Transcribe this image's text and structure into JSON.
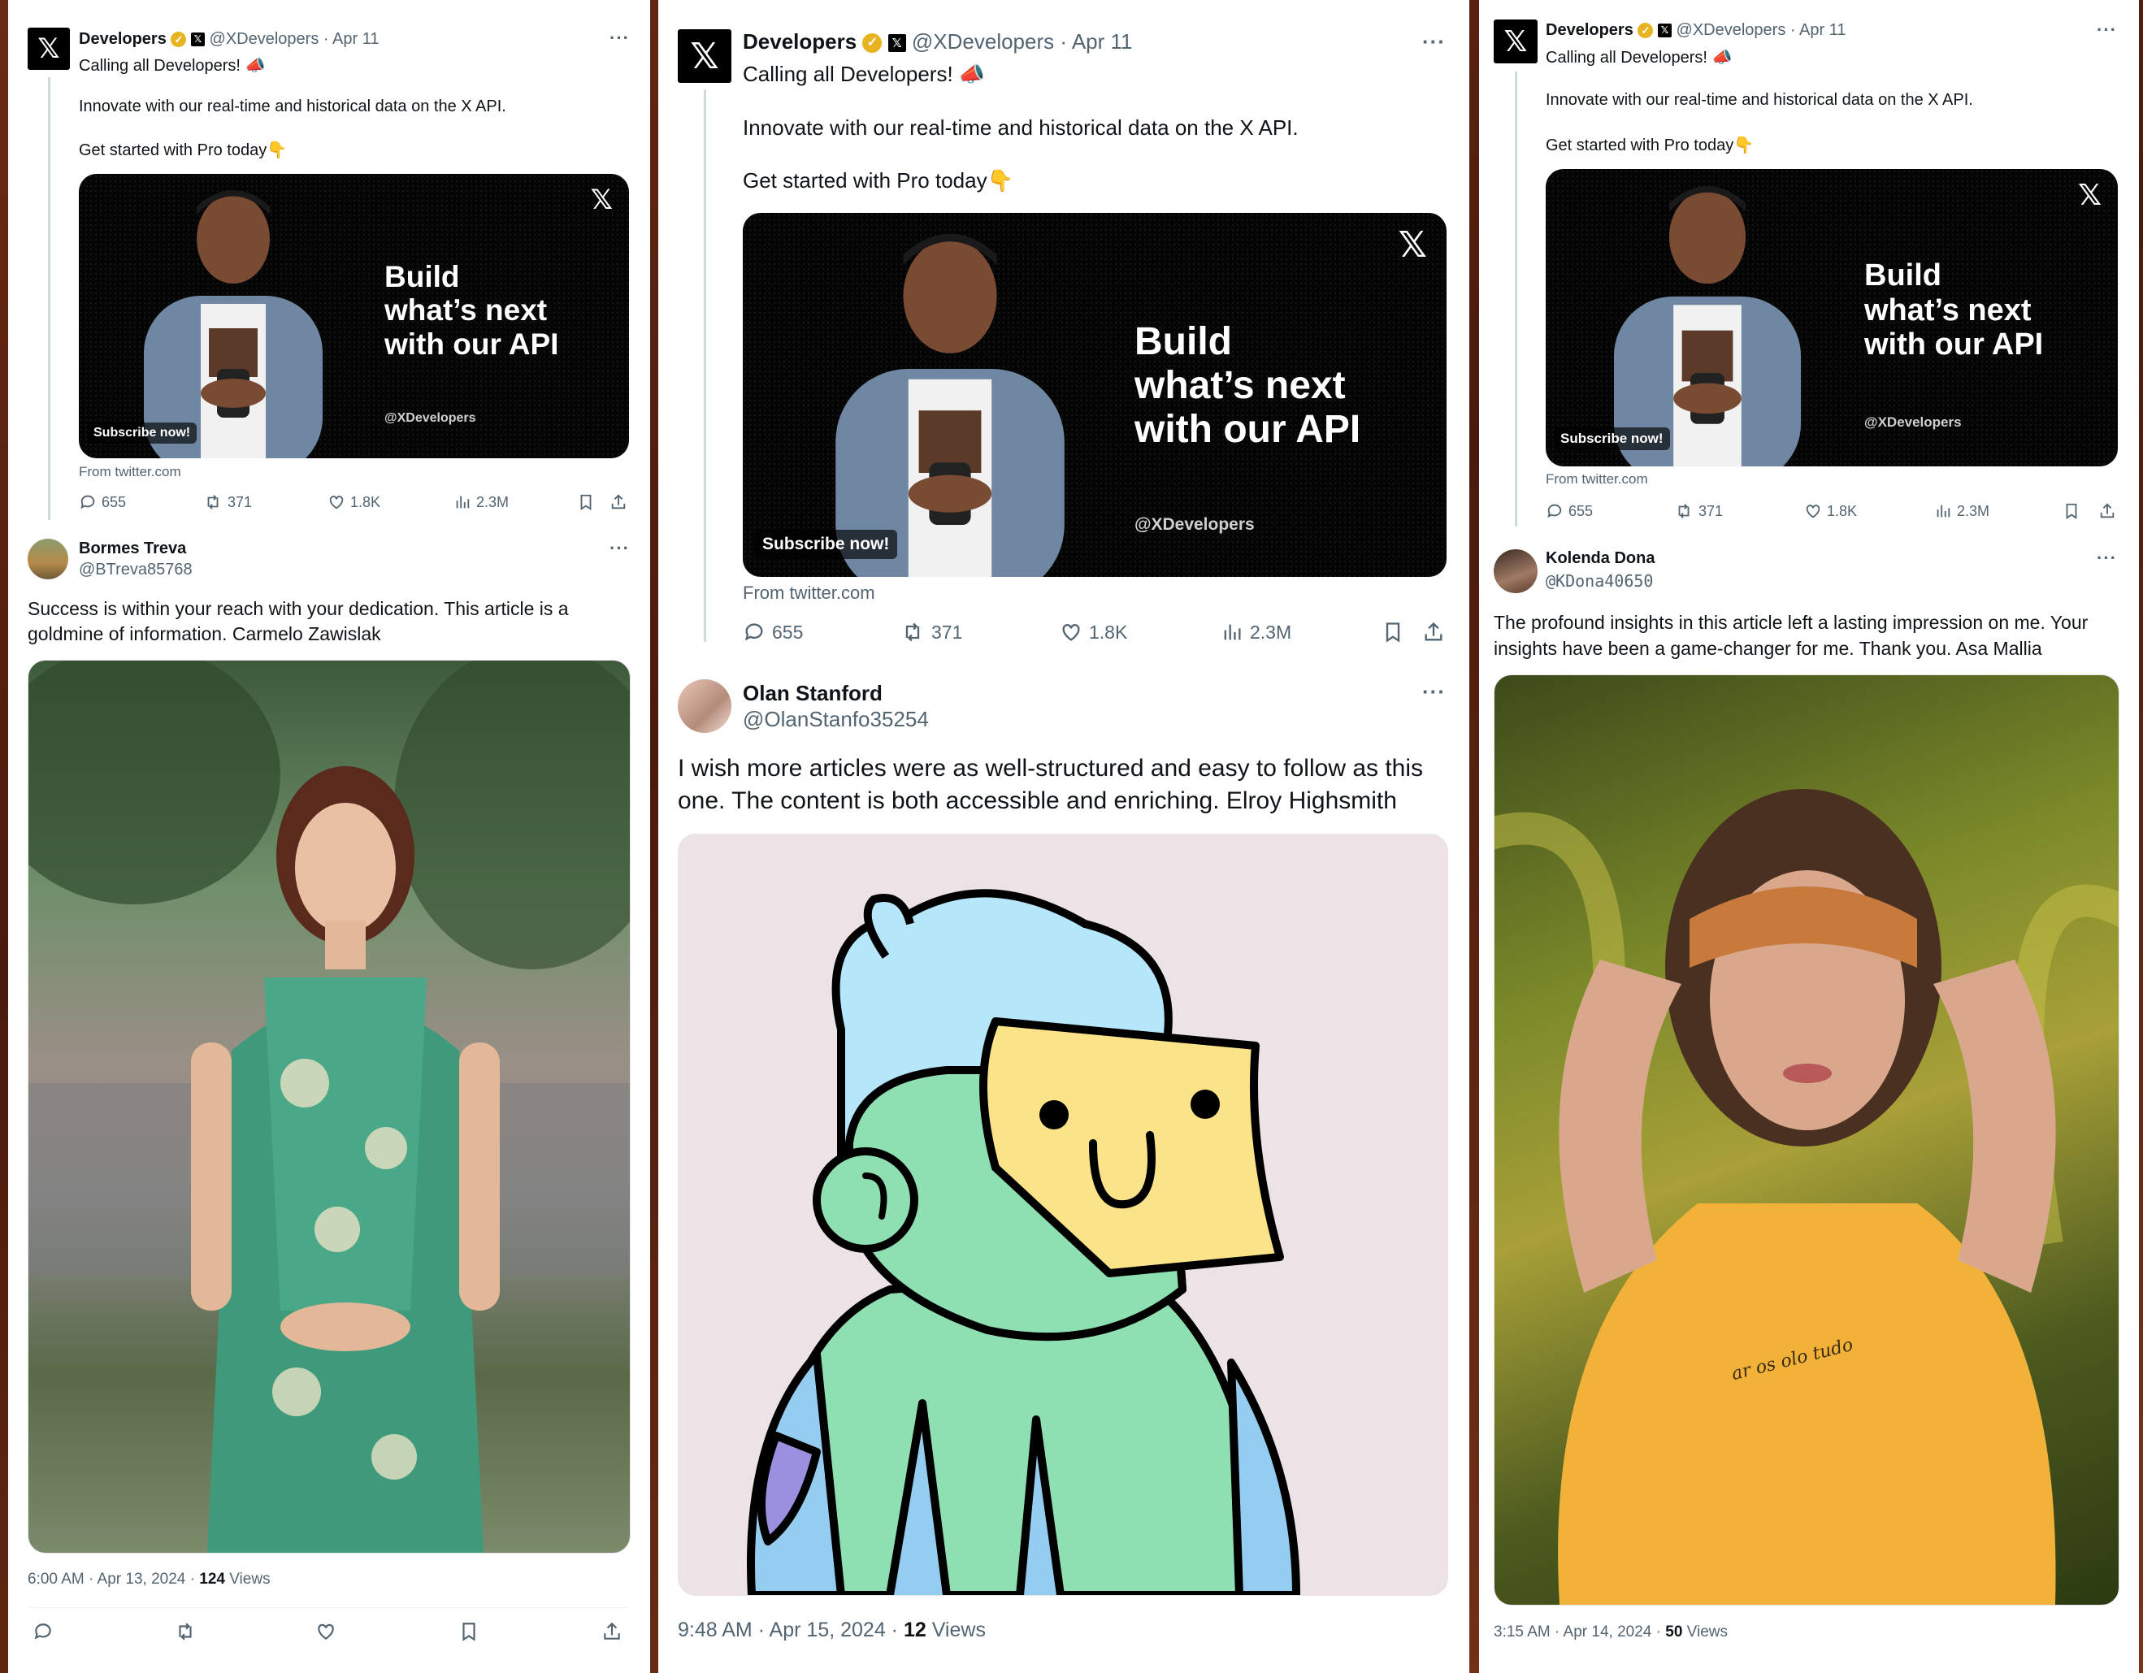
{
  "promo": {
    "name": "Developers",
    "handle": "@XDevelopers",
    "date": "· Apr 11",
    "line1": "Calling all Developers! 📣",
    "line2": "Innovate with our real-time and historical data on the X API.",
    "line3": "Get started with Pro today👇",
    "headline1": "Build",
    "headline2": "what’s next",
    "headline3": "with our API",
    "card_handle": "@XDevelopers",
    "subscribe": "Subscribe now!",
    "source": "From twitter.com",
    "replies": "655",
    "reposts": "371",
    "likes": "1.8K",
    "views": "2.3M"
  },
  "post1": {
    "name": "Bormes Treva",
    "handle": "@BTreva85768",
    "text": "Success is within your reach with your dedication. This article is a goldmine of information. Carmelo Zawislak",
    "time": "6:00 AM · Apr 13, 2024 · ",
    "views_count": "124",
    "views_label": " Views"
  },
  "post2": {
    "name": "Olan Stanford",
    "handle": "@OlanStanfo35254",
    "text": "I wish more articles were as well-structured and easy to follow as this one. The content is both accessible and enriching. Elroy Highsmith",
    "time": "9:48 AM · Apr 15, 2024 · ",
    "views_count": "12",
    "views_label": " Views"
  },
  "post3": {
    "name": "Kolenda Dona",
    "handle": "@KDona40650",
    "text": "The profound insights in this article left a lasting impression on me. Your insights have been a game-changer for me. Thank you. Asa Mallia",
    "time": "3:15 AM · Apr 14, 2024 · ",
    "views_count": "50",
    "views_label": " Views"
  },
  "shirt_text": "ar os olo tudo",
  "colors": {
    "text": "#0f1419",
    "muted": "#536471",
    "verified": "#e8b321"
  },
  "icons": [
    "reply-icon",
    "repost-icon",
    "like-icon",
    "views-icon",
    "bookmark-icon",
    "share-icon",
    "more-icon",
    "x-logo-icon"
  ]
}
